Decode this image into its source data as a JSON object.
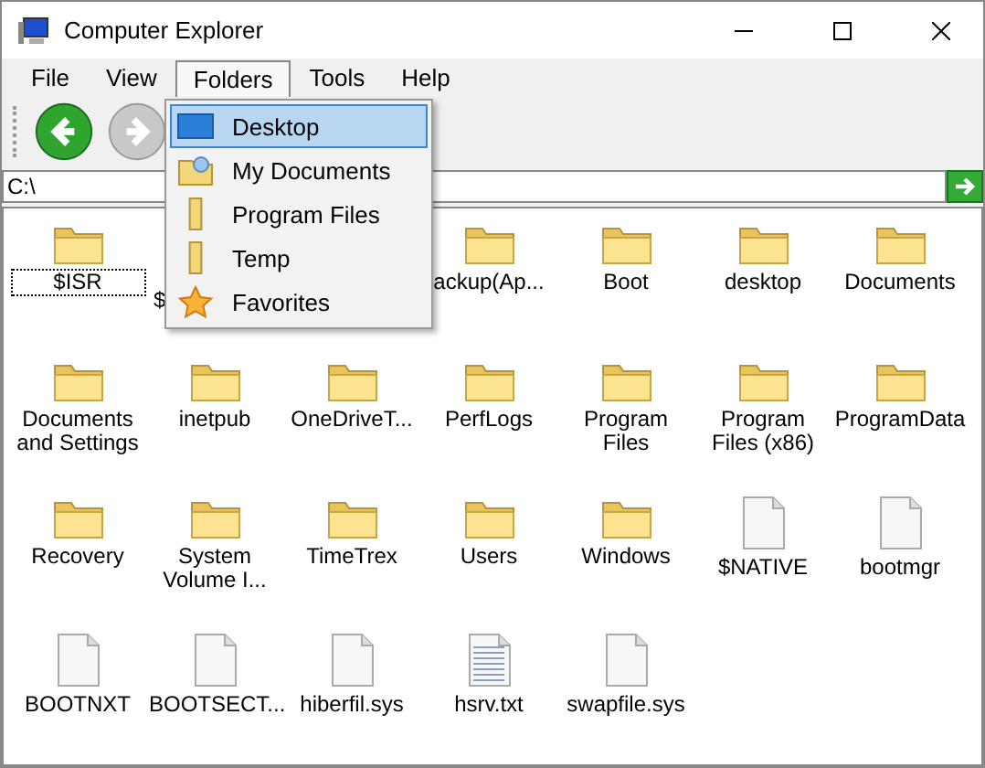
{
  "window": {
    "title": "Computer Explorer"
  },
  "menu": [
    {
      "label": "File",
      "selected": false
    },
    {
      "label": "View",
      "selected": false
    },
    {
      "label": "Folders",
      "selected": true
    },
    {
      "label": "Tools",
      "selected": false
    },
    {
      "label": "Help",
      "selected": false
    }
  ],
  "toolbar": [
    {
      "kind": "back",
      "disabled": false
    },
    {
      "kind": "forward",
      "disabled": true
    }
  ],
  "address": {
    "value": "C:\\"
  },
  "dropdown": [
    {
      "label": "Desktop",
      "kind": "desktop",
      "selected": true
    },
    {
      "label": "My Documents",
      "kind": "documents",
      "selected": false
    },
    {
      "label": "Program Files",
      "kind": "folder",
      "selected": false
    },
    {
      "label": "Temp",
      "kind": "folder",
      "selected": false
    },
    {
      "label": "Favorites",
      "kind": "star",
      "selected": false
    }
  ],
  "files": [
    {
      "label": "$ISR",
      "kind": "folder",
      "selected": true
    },
    {
      "label": "$",
      "kind": "partial"
    },
    {
      "label": "ackup(Ap...",
      "kind": "folder"
    },
    {
      "label": "Boot",
      "kind": "folder"
    },
    {
      "label": "desktop",
      "kind": "folder"
    },
    {
      "label": "Documents",
      "kind": "folder"
    },
    {
      "label": "Documents and Settings",
      "kind": "folder"
    },
    {
      "label": "inetpub",
      "kind": "folder"
    },
    {
      "label": "OneDriveT...",
      "kind": "folder"
    },
    {
      "label": "PerfLogs",
      "kind": "folder"
    },
    {
      "label": "Program Files",
      "kind": "folder"
    },
    {
      "label": "Program Files (x86)",
      "kind": "folder"
    },
    {
      "label": "ProgramData",
      "kind": "folder"
    },
    {
      "label": "Recovery",
      "kind": "folder"
    },
    {
      "label": "System Volume I...",
      "kind": "folder"
    },
    {
      "label": "TimeTrex",
      "kind": "folder"
    },
    {
      "label": "Users",
      "kind": "folder"
    },
    {
      "label": "Windows",
      "kind": "folder"
    },
    {
      "label": "$NATIVE",
      "kind": "file"
    },
    {
      "label": "bootmgr",
      "kind": "file"
    },
    {
      "label": "BOOTNXT",
      "kind": "file"
    },
    {
      "label": "BOOTSECT...",
      "kind": "file"
    },
    {
      "label": "hiberfil.sys",
      "kind": "file"
    },
    {
      "label": "hsrv.txt",
      "kind": "text"
    },
    {
      "label": "swapfile.sys",
      "kind": "file"
    }
  ]
}
